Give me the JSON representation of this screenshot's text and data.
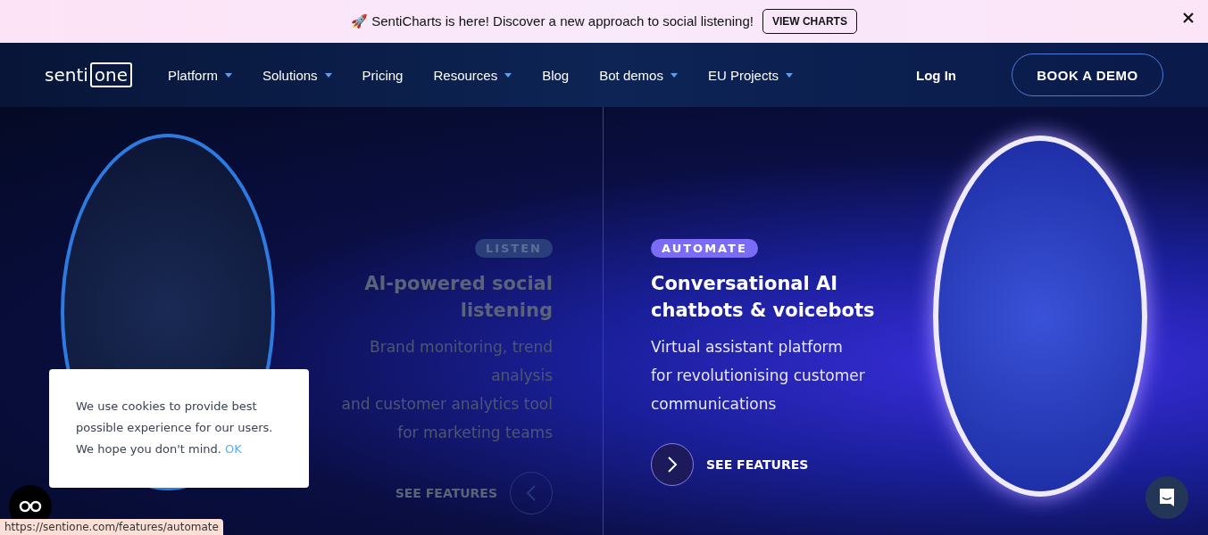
{
  "announcement": {
    "emoji": "🚀",
    "text": "SentiCharts is here! Discover a new approach to social listening!",
    "button": "VIEW CHARTS"
  },
  "logo": {
    "part_1": "senti",
    "part_2": "one"
  },
  "nav": {
    "items": [
      {
        "label": "Platform",
        "dropdown": true
      },
      {
        "label": "Solutions",
        "dropdown": true
      },
      {
        "label": "Pricing",
        "dropdown": false
      },
      {
        "label": "Resources",
        "dropdown": true
      },
      {
        "label": "Blog",
        "dropdown": false
      },
      {
        "label": "Bot demos",
        "dropdown": true
      },
      {
        "label": "EU Projects",
        "dropdown": true
      }
    ],
    "login": "Log In",
    "cta": "BOOK A DEMO"
  },
  "panels": [
    {
      "badge": "LISTEN",
      "selected": false,
      "title": "AI-powered social listening",
      "description": [
        "Brand monitoring, trend",
        "analysis",
        "and customer analytics tool",
        "for marketing teams"
      ],
      "link": "SEE FEATURES"
    },
    {
      "badge": "AUTOMATE",
      "selected": true,
      "title": "Conversational AI chatbots & voicebots",
      "description": [
        "Virtual assistant platform",
        "for revolutionising customer",
        "communications"
      ],
      "link": "SEE FEATURES"
    }
  ],
  "cookie_notice": {
    "text": "We use cookies to provide best possible experience for our users. We hope you don't mind.",
    "ok": "OK"
  },
  "status_url": "https://sentione.com/features/automate"
}
